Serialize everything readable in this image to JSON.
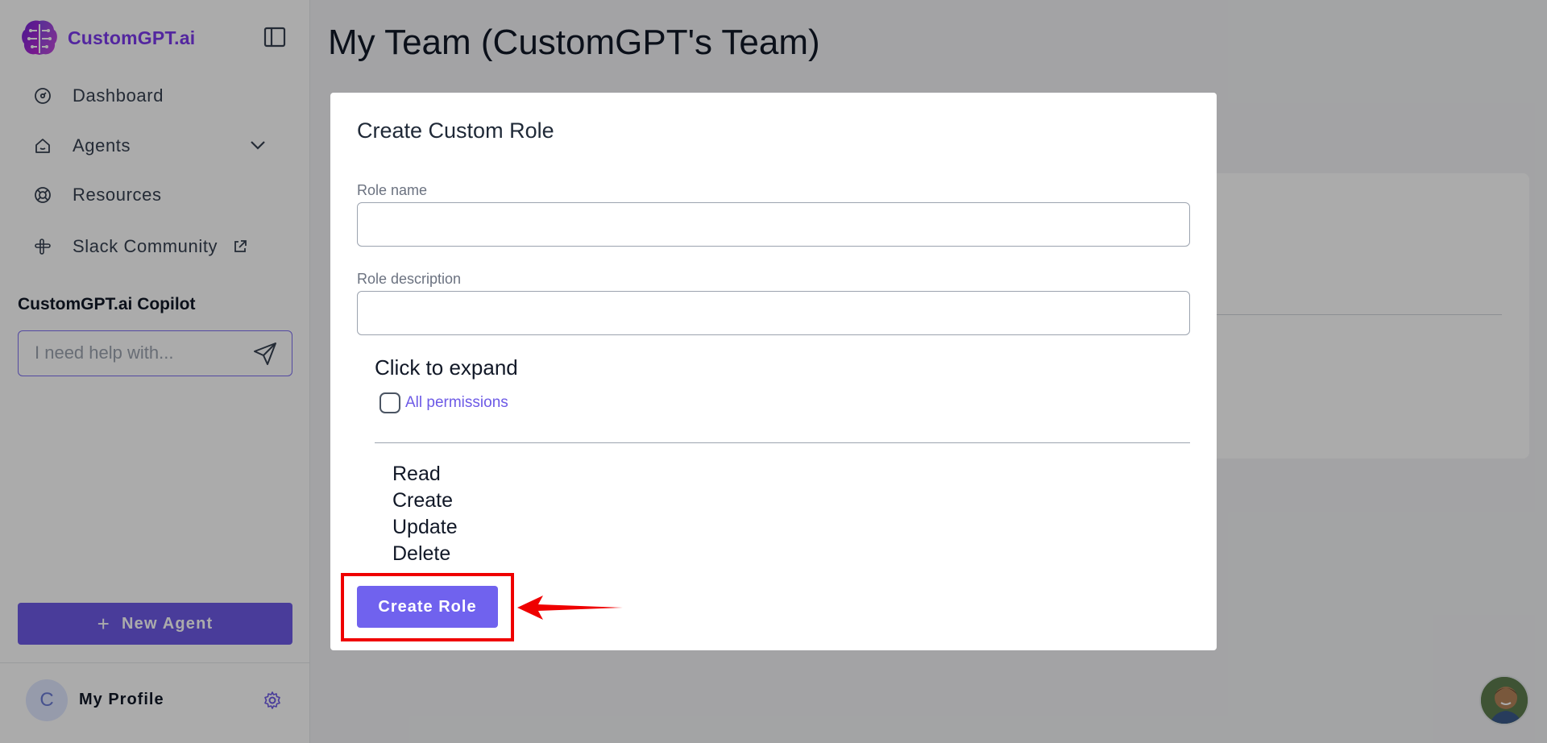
{
  "sidebar": {
    "brand": "CustomGPT.ai",
    "nav": [
      {
        "label": "Dashboard",
        "icon": "gauge-icon"
      },
      {
        "label": "Agents",
        "icon": "home-icon"
      },
      {
        "label": "Resources",
        "icon": "lifebuoy-icon"
      },
      {
        "label": "Slack Community",
        "icon": "slack-icon"
      }
    ],
    "copilot_title": "CustomGPT.ai Copilot",
    "copilot_placeholder": "I need help with...",
    "new_agent_label": "New Agent",
    "avatar_initial": "C",
    "profile_label": "My Profile"
  },
  "page": {
    "title": "My Team (CustomGPT's Team)"
  },
  "modal": {
    "title": "Create Custom Role",
    "role_name_label": "Role name",
    "role_name_value": "",
    "role_description_label": "Role description",
    "role_description_value": "",
    "expand_title": "Click to expand",
    "all_permissions_label": "All permissions",
    "all_permissions_checked": false,
    "permissions": [
      "Read",
      "Create",
      "Update",
      "Delete"
    ],
    "create_button_label": "Create Role"
  },
  "colors": {
    "brand": "#7c3aed",
    "primary_button": "#6d5ae6",
    "annotation": "#ef0000"
  }
}
